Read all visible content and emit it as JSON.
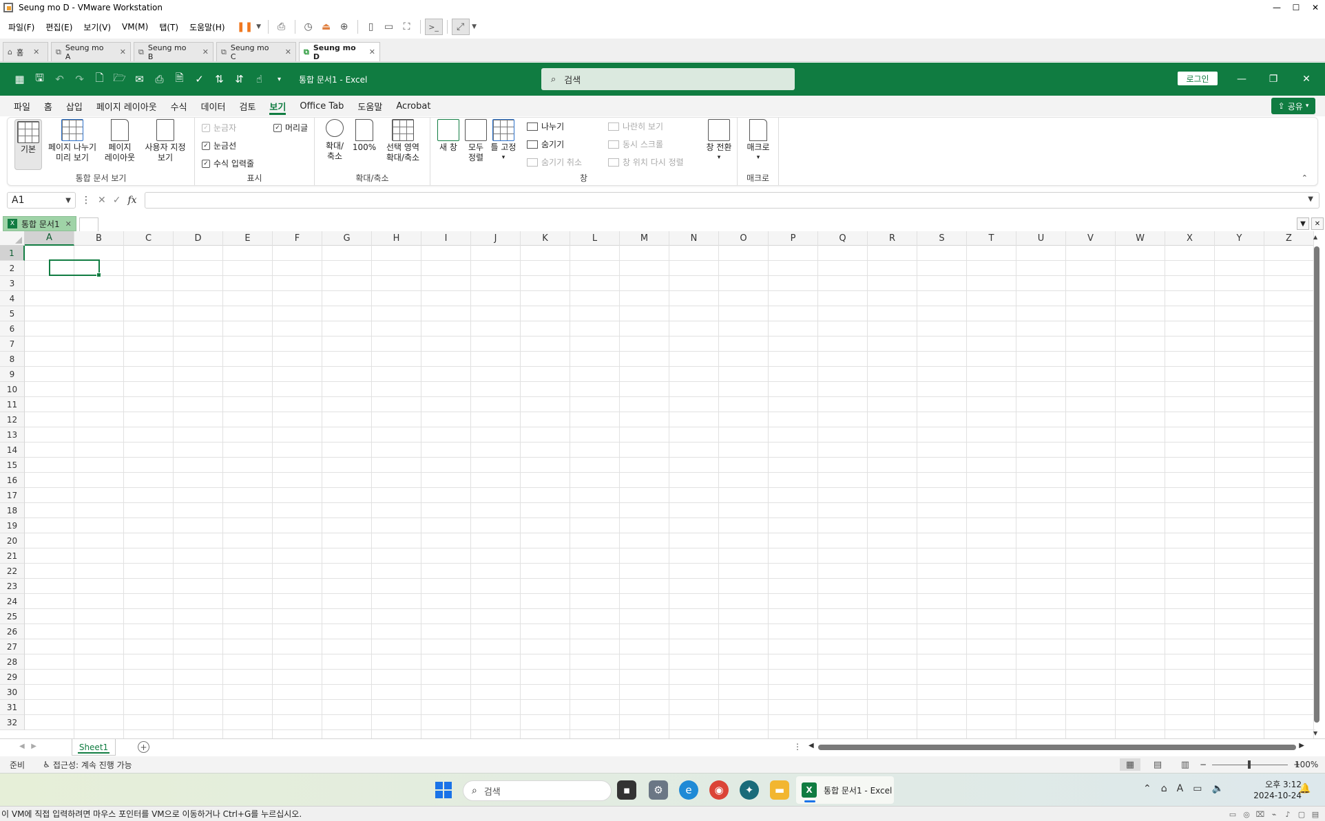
{
  "vm": {
    "title": "Seung mo D - VMware Workstation",
    "menu": [
      "파일(F)",
      "편집(E)",
      "보기(V)",
      "VM(M)",
      "탭(T)",
      "도움말(H)"
    ],
    "tabs": [
      {
        "label": "홈"
      },
      {
        "label": "Seung mo A"
      },
      {
        "label": "Seung mo B"
      },
      {
        "label": "Seung mo C"
      },
      {
        "label": "Seung mo D"
      }
    ],
    "status_text": "이 VM에 직접 입력하려면 마우스 포인터를 VM으로 이동하거나 Ctrl+G를 누르십시오."
  },
  "excel": {
    "doc_title": "통합 문서1  -  Excel",
    "search_placeholder": "검색",
    "login_label": "로그인",
    "share_label": "공유",
    "ribbon_tabs": [
      "파일",
      "홈",
      "삽입",
      "페이지 레이아웃",
      "수식",
      "데이터",
      "검토",
      "보기",
      "Office Tab",
      "도움말",
      "Acrobat"
    ],
    "ribbon": {
      "workbook_views": {
        "label": "통합 문서 보기",
        "normal": "기본",
        "page_break_1": "페이지 나누기",
        "page_break_2": "미리 보기",
        "page_layout_1": "페이지",
        "page_layout_2": "레이아웃",
        "custom_1": "사용자 지정",
        "custom_2": "보기"
      },
      "show": {
        "label": "표시",
        "ruler": "눈금자",
        "gridlines": "눈금선",
        "formula_bar": "수식 입력줄",
        "headings": "머리글"
      },
      "zoom": {
        "label": "확대/축소",
        "zoom_1": "확대/",
        "zoom_2": "축소",
        "hundred": "100%",
        "selection_1": "선택 영역",
        "selection_2": "확대/축소"
      },
      "window": {
        "label": "창",
        "new_window": "새 창",
        "arrange_1": "모두",
        "arrange_2": "정렬",
        "freeze": "틀 고정",
        "split": "나누기",
        "hide": "숨기기",
        "unhide": "숨기기 취소",
        "side_by_side": "나란히 보기",
        "sync_scroll": "동시 스크롤",
        "reset_position": "창 위치 다시 정렬",
        "switch": "창 전환"
      },
      "macros": {
        "label": "매크로",
        "macros": "매크로"
      }
    },
    "name_box": "A1",
    "fx_label": "fx",
    "doc_tab": "통합 문서1",
    "columns": [
      "A",
      "B",
      "C",
      "D",
      "E",
      "F",
      "G",
      "H",
      "I",
      "J",
      "K",
      "L",
      "M",
      "N",
      "O",
      "P",
      "Q",
      "R",
      "S",
      "T",
      "U",
      "V",
      "W",
      "X",
      "Y",
      "Z"
    ],
    "rows": [
      "1",
      "2",
      "3",
      "4",
      "5",
      "6",
      "7",
      "8",
      "9",
      "10",
      "11",
      "12",
      "13",
      "14",
      "15",
      "16",
      "17",
      "18",
      "19",
      "20",
      "21",
      "22",
      "23",
      "24",
      "25",
      "26",
      "27",
      "28",
      "29",
      "30",
      "31",
      "32"
    ],
    "sheet_tab": "Sheet1",
    "status_ready": "준비",
    "status_accessibility": "접근성: 계속 진행 가능",
    "zoom_pct": "100%"
  },
  "taskbar": {
    "search_placeholder": "검색",
    "excel_label": "통합 문서1 - Excel",
    "time": "오후 3:12",
    "date": "2024-10-24"
  }
}
